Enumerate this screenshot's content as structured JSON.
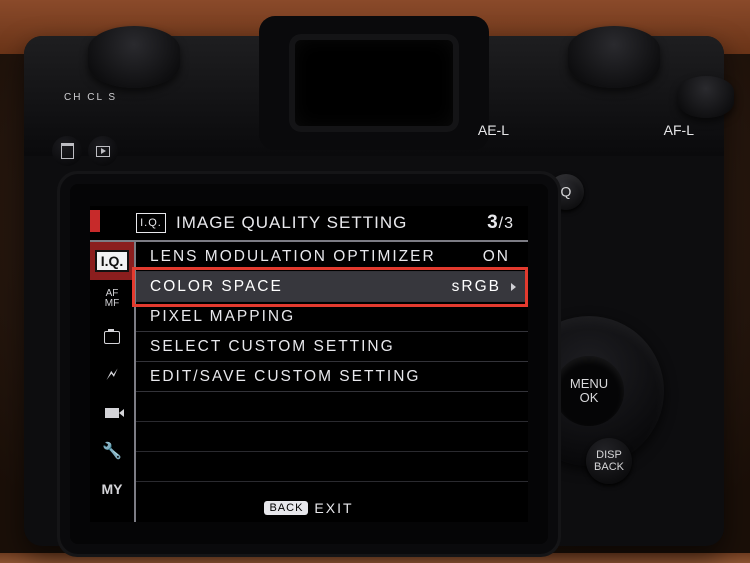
{
  "top_plate": {
    "dial_marks": "CH CL S",
    "label_ael": "AE-L",
    "label_afl": "AF-L"
  },
  "buttons": {
    "q": "Q",
    "menu_ok_line1": "MENU",
    "menu_ok_line2": "OK",
    "disp_back_line1": "DISP",
    "disp_back_line2": "BACK"
  },
  "menu": {
    "header_icon": "I.Q.",
    "header_title": "IMAGE QUALITY SETTING",
    "page_current": "3",
    "page_total": "/3",
    "tabs": {
      "iq": "I.Q.",
      "af_top": "AF",
      "af_bot": "MF",
      "my": "MY"
    },
    "rows": [
      {
        "label": "LENS MODULATION OPTIMIZER",
        "value": "ON",
        "selected": false,
        "arrow": false
      },
      {
        "label": "COLOR SPACE",
        "value": "sRGB",
        "selected": true,
        "arrow": true
      },
      {
        "label": "PIXEL MAPPING",
        "value": "",
        "selected": false,
        "arrow": false
      },
      {
        "label": "SELECT CUSTOM SETTING",
        "value": "",
        "selected": false,
        "arrow": false
      },
      {
        "label": "EDIT/SAVE CUSTOM SETTING",
        "value": "",
        "selected": false,
        "arrow": false
      }
    ],
    "footer_back": "BACK",
    "footer_exit": "EXIT"
  }
}
